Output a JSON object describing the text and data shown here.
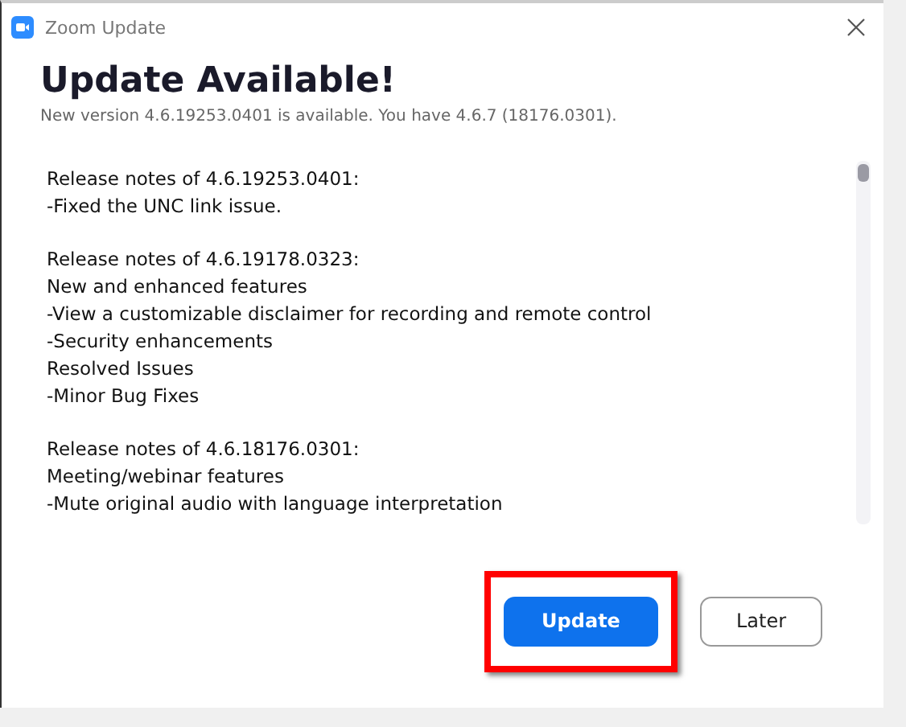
{
  "window": {
    "title": "Zoom Update"
  },
  "heading": "Update Available!",
  "subtitle": "New version 4.6.19253.0401 is available. You have 4.6.7 (18176.0301).",
  "release_notes": [
    {
      "lines": [
        "Release notes of 4.6.19253.0401:",
        "-Fixed the UNC link issue."
      ]
    },
    {
      "lines": [
        "Release notes of 4.6.19178.0323:",
        "New and enhanced features",
        "-View a customizable disclaimer for recording and remote control",
        "-Security enhancements",
        "Resolved Issues",
        "-Minor Bug Fixes"
      ]
    },
    {
      "lines": [
        "Release notes of 4.6.18176.0301:",
        "Meeting/webinar features",
        "-Mute original audio with language interpretation"
      ]
    }
  ],
  "buttons": [
    {
      "label": "Update",
      "kind": "primary",
      "highlighted": true
    },
    {
      "label": "Later",
      "kind": "secondary",
      "highlighted": false
    }
  ]
}
